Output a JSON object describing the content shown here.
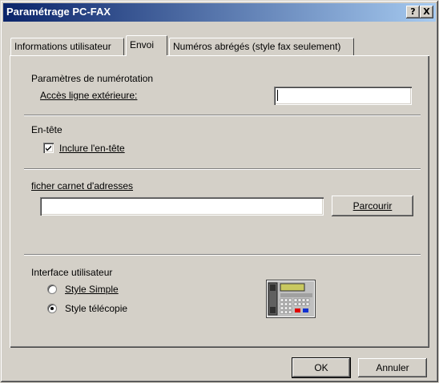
{
  "window": {
    "title": "Paramétrage PC-FAX",
    "help_symbol": "?",
    "close_symbol": "X"
  },
  "tabs": [
    {
      "label": "Informations utilisateur"
    },
    {
      "label": "Envoi"
    },
    {
      "label": "Numéros abrégés (style fax seulement)"
    }
  ],
  "dialing": {
    "heading": "Paramètres de numérotation",
    "outside_line_label": "Accès ligne extérieure:",
    "outside_line_value": ""
  },
  "header_section": {
    "heading": "En-tête",
    "include_label": "Inclure l'en-tête",
    "include_checked": true
  },
  "address_book": {
    "heading": "ficher carnet d'adresses",
    "path_value": "",
    "browse_label": "Parcourir"
  },
  "interface": {
    "heading": "Interface utilisateur",
    "options": [
      {
        "label": "Style Simple",
        "selected": false
      },
      {
        "label": "Style télécopie",
        "selected": true
      }
    ],
    "icon": "fax-machine-icon"
  },
  "footer": {
    "ok_label": "OK",
    "cancel_label": "Annuler"
  },
  "colors": {
    "title_gradient_start": "#0a246a",
    "title_gradient_end": "#a6caf0",
    "face": "#d4d0c8"
  }
}
